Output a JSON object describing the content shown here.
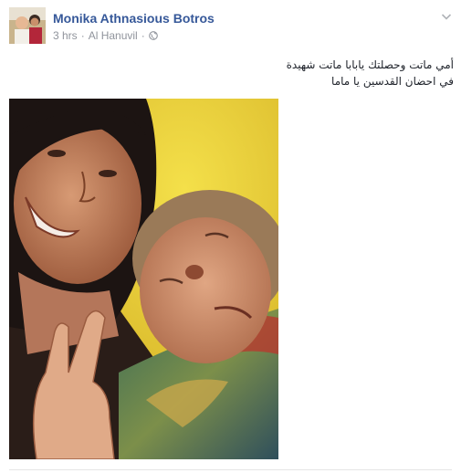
{
  "post": {
    "author": "Monika Athnasious Botros",
    "time": "3 hrs",
    "separator": "·",
    "location": "Al Hanuvil",
    "privacy_icon": "globe-icon",
    "menu_icon": "chevron-down-icon",
    "text_lines": [
      "أمي ماتت وحصلتك يابابا ماتت شهيدة",
      "في احضان القدسين يا ماما"
    ]
  },
  "colors": {
    "author_link": "#365899",
    "meta_text": "#90949c",
    "body_text": "#1d2129",
    "photo_background": "#e9d23a"
  }
}
